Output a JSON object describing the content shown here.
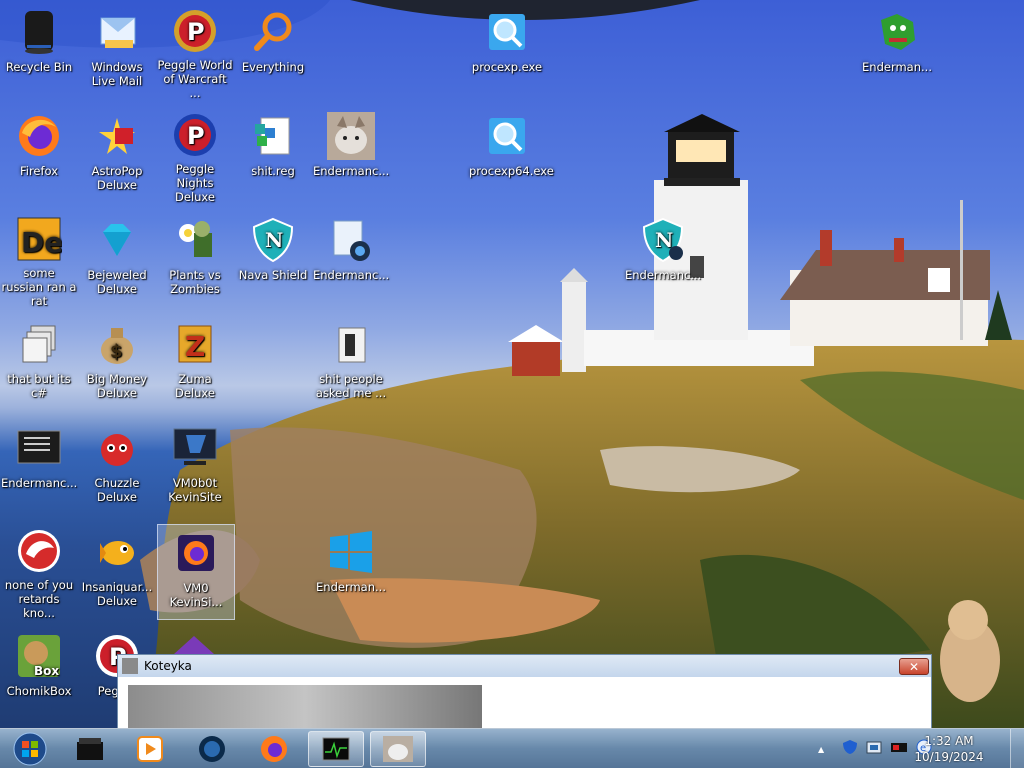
{
  "colors": {
    "taskbar": "#6f8eb0",
    "sky": "#4a6fdc",
    "popup_close": "#c8442c"
  },
  "desktop_icons": [
    {
      "label": "Recycle Bin",
      "icon": "recycle-bin-icon"
    },
    {
      "label": "Windows Live Mail",
      "icon": "mail-icon"
    },
    {
      "label": "Peggle World of Warcraft ...",
      "icon": "peggle-icon"
    },
    {
      "label": "Everything",
      "icon": "magnifier-icon"
    },
    {
      "label": "procexp.exe",
      "icon": "procexp-icon"
    },
    {
      "label": "Enderman...",
      "icon": "dragon-icon"
    },
    {
      "label": "Firefox",
      "icon": "firefox-icon"
    },
    {
      "label": "AstroPop Deluxe",
      "icon": "astropop-icon"
    },
    {
      "label": "Peggle Nights Deluxe",
      "icon": "peggle-nights-icon"
    },
    {
      "label": "shit.reg",
      "icon": "registry-file-icon"
    },
    {
      "label": "Endermanc...",
      "icon": "cat-photo-icon"
    },
    {
      "label": "procexp64.exe",
      "icon": "procexp-icon"
    },
    {
      "label": "some russian ran a rat",
      "icon": "de-app-icon"
    },
    {
      "label": "Bejeweled Deluxe",
      "icon": "gem-icon"
    },
    {
      "label": "Plants vs Zombies",
      "icon": "plant-icon"
    },
    {
      "label": "Nava Shield",
      "icon": "shield-icon"
    },
    {
      "label": "Endermanc...",
      "icon": "shortcut-icon"
    },
    {
      "label": "Endermanc...",
      "icon": "shield-icon"
    },
    {
      "label": "that but its c#",
      "icon": "windows-stack-icon"
    },
    {
      "label": "Big Money Deluxe",
      "icon": "money-bag-icon"
    },
    {
      "label": "Zuma Deluxe",
      "icon": "zuma-icon"
    },
    {
      "label": "shit people asked me ...",
      "icon": "folder-icon"
    },
    {
      "label": "Endermanc...",
      "icon": "console-icon"
    },
    {
      "label": "Chuzzle Deluxe",
      "icon": "chuzzle-icon"
    },
    {
      "label": "VM0b0t KevinSite",
      "icon": "vm-icon"
    },
    {
      "label": "none of you retards kno...",
      "icon": "red-dragon-icon"
    },
    {
      "label": "Insaniquar... Deluxe",
      "icon": "fish-icon"
    },
    {
      "label": "VM0 KevinSi...",
      "icon": "firefox-purple-icon"
    },
    {
      "label": "Enderman...",
      "icon": "windows-logo-icon"
    },
    {
      "label": "ChomikBox",
      "icon": "hamster-icon"
    },
    {
      "label": "Peggle",
      "icon": "peggle-icon"
    }
  ],
  "popup": {
    "title": "Koteyka",
    "message": "",
    "close_symbol": "✕"
  },
  "taskbar": {
    "buttons": [
      "start-orb",
      "black-app",
      "media-player",
      "globe-app",
      "firefox",
      "task-manager",
      "koteyka"
    ],
    "tray_icons": [
      "show-hidden",
      "security",
      "network",
      "battery",
      "volume"
    ],
    "show_hidden_symbol": "▲",
    "time": "1:32 AM",
    "date": "10/19/2024"
  }
}
